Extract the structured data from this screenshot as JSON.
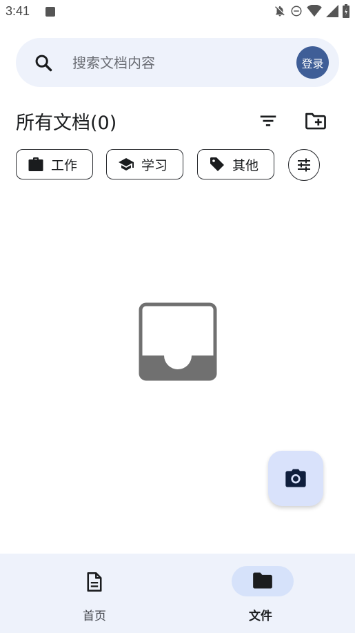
{
  "status_bar": {
    "time": "3:41"
  },
  "search": {
    "placeholder": "搜索文档内容",
    "login_label": "登录"
  },
  "section": {
    "title": "所有文档(0)"
  },
  "chips": [
    {
      "label": "工作",
      "icon": "briefcase-icon"
    },
    {
      "label": "学习",
      "icon": "school-icon"
    },
    {
      "label": "其他",
      "icon": "tag-icon"
    }
  ],
  "bottom_nav": {
    "items": [
      {
        "label": "首页",
        "icon": "document-icon",
        "active": false
      },
      {
        "label": "文件",
        "icon": "folder-icon",
        "active": true
      }
    ]
  },
  "colors": {
    "accent": "#3f5e97",
    "surface": "#eef2fb",
    "fab": "#d9e2fb",
    "nav_indicator": "#d6e2fa"
  }
}
